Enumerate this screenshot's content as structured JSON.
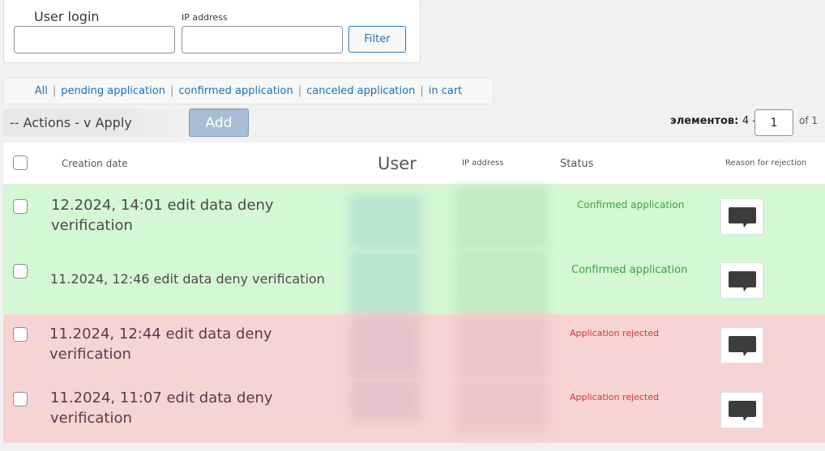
{
  "filters": {
    "user_login_label": "User login",
    "ip_label": "IP address",
    "filter_button": "Filter"
  },
  "views": [
    {
      "label": "All"
    },
    {
      "label": "pending application"
    },
    {
      "label": "confirmed application"
    },
    {
      "label": "canceled application"
    },
    {
      "label": "in cart"
    }
  ],
  "bulk": {
    "actions_label": "-- Actions - v Apply",
    "add_button": "Add"
  },
  "pagination": {
    "items_label": "элементов:",
    "items_value": "4 -",
    "current_page": "1",
    "of_label": "of 1"
  },
  "table": {
    "headers": {
      "creation_date": "Creation date",
      "user": "User",
      "ip": "IP address",
      "status": "Status",
      "reason": "Reason for rejection"
    },
    "rows": [
      {
        "date_line1": "12.2024, 14:01 edit data deny",
        "date_line2": "verification",
        "status": "Confirmed application",
        "state": "confirmed"
      },
      {
        "date_line1": "11.2024, 12:46 edit data deny verification",
        "date_line2": "",
        "status": "Confirmed application",
        "state": "confirmed"
      },
      {
        "date_line1": "11.2024, 12:44 edit data deny",
        "date_line2": "verification",
        "status": "Application rejected",
        "state": "rejected"
      },
      {
        "date_line1": "11.2024, 11:07 edit data deny",
        "date_line2": "verification",
        "status": "Application rejected",
        "state": "rejected"
      }
    ]
  },
  "colors": {
    "confirmed_row": "#d4f7d4",
    "rejected_row": "#f7d4d4",
    "confirmed_text": "#3aa63a",
    "rejected_text": "#d63638",
    "link": "#2271b1"
  },
  "icons": {
    "reason": "speech-bubble-icon"
  }
}
